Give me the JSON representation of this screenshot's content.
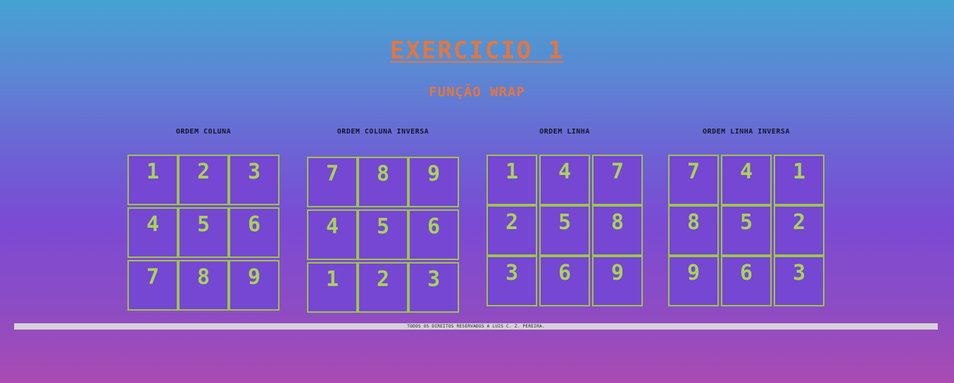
{
  "header": {
    "title": "EXERCICIO 1",
    "subtitle": "FUNÇÃO WRAP"
  },
  "grids": [
    {
      "label": "ORDEM COLUNA",
      "cells": [
        "1",
        "2",
        "3",
        "4",
        "5",
        "6",
        "7",
        "8",
        "9"
      ]
    },
    {
      "label": "ORDEM COLUNA INVERSA",
      "cells": [
        "7",
        "8",
        "9",
        "4",
        "5",
        "6",
        "1",
        "2",
        "3"
      ]
    },
    {
      "label": "ORDEM LINHA",
      "cells": [
        "1",
        "4",
        "7",
        "2",
        "5",
        "8",
        "3",
        "6",
        "9"
      ]
    },
    {
      "label": "ORDEM LINHA INVERSA",
      "cells": [
        "7",
        "4",
        "1",
        "8",
        "5",
        "2",
        "9",
        "6",
        "3"
      ]
    }
  ],
  "footer": {
    "text": "TODOS OS DIREITOS RESERVADOS A LUIS C. Z. PEREIRA."
  },
  "colors": {
    "title": "#e4763f",
    "cell_background": "#7547d2",
    "cell_border": "#9cc64a",
    "cell_text": "#a8d35a",
    "footer_bar": "#d6d1d8"
  }
}
